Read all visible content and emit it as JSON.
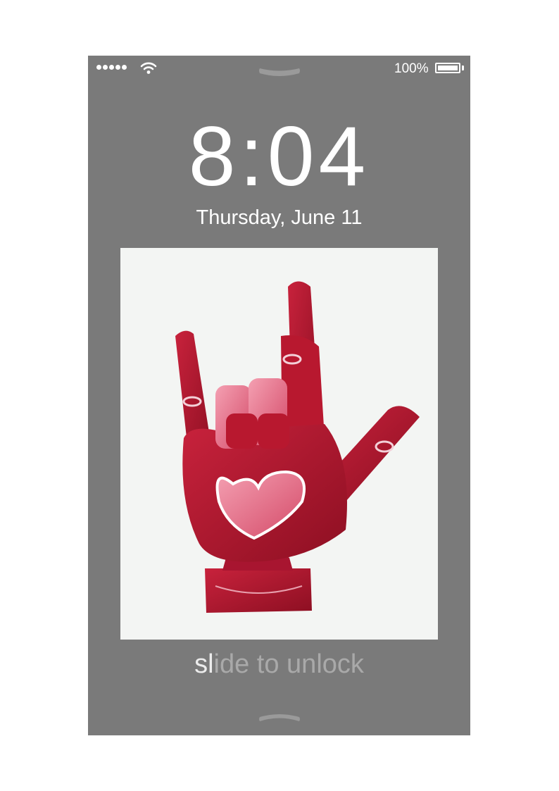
{
  "status_bar": {
    "signal_dots": 5,
    "battery_percent": "100%",
    "battery_level": 1.0,
    "icons": [
      "signal-dots-icon",
      "wifi-icon",
      "battery-icon"
    ]
  },
  "lock_screen": {
    "time": "8:04",
    "date": "Thursday, June 11",
    "unlock_hint_highlight": "sl",
    "unlock_hint_rest": "ide to unlock"
  },
  "wallpaper": {
    "subject": "red-hand-sculpture-with-heart",
    "colors": {
      "primary": "#b3142c",
      "highlight": "#e8607a",
      "background": "#f3f5f3"
    }
  },
  "colors": {
    "screen": "#7a7a7a",
    "text": "#ffffff",
    "hint": "#a9a9a9"
  }
}
